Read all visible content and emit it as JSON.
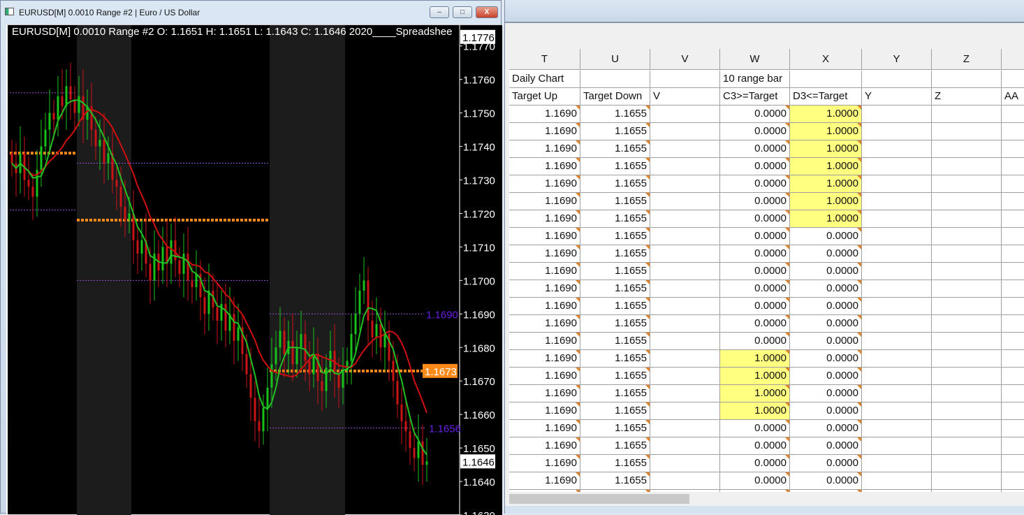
{
  "chart_window": {
    "title": "EURUSD[M]  0.0010 Range  #2 | Euro / US Dollar",
    "info_line": "EURUSD[M]  0.0010 Range  #2 O: 1.1651 H: 1.1651 L: 1.1643 C: 1.1646 2020____Spreadshee",
    "buttons": {
      "minimize": "–",
      "maximize": "□",
      "close": "X"
    }
  },
  "chart_data": {
    "type": "candlestick",
    "symbol": "EURUSD[M]",
    "ylim": [
      1.163,
      1.17762
    ],
    "y_ticks": [
      "1.1770",
      "1.1760",
      "1.1750",
      "1.1740",
      "1.1730",
      "1.1720",
      "1.1710",
      "1.1700",
      "1.1690",
      "1.1680",
      "1.1670",
      "1.1660",
      "1.1650",
      "1.1640",
      "1.1630"
    ],
    "top_price_label": "1.1776",
    "current_price_label": "1.1646",
    "current_price": 1.1646,
    "closes": [
      1.1735,
      1.1732,
      1.1738,
      1.173,
      1.1728,
      1.1725,
      1.1733,
      1.174,
      1.1745,
      1.175,
      1.1748,
      1.1755,
      1.1752,
      1.1758,
      1.1754,
      1.175,
      1.1755,
      1.1748,
      1.1752,
      1.1745,
      1.174,
      1.1742,
      1.1735,
      1.1738,
      1.173,
      1.1728,
      1.1722,
      1.1718,
      1.172,
      1.1712,
      1.1708,
      1.1712,
      1.1705,
      1.17,
      1.1708,
      1.1703,
      1.171,
      1.1705,
      1.1712,
      1.1706,
      1.1702,
      1.1708,
      1.17,
      1.1698,
      1.1702,
      1.1695,
      1.169,
      1.1697,
      1.1692,
      1.1688,
      1.1693,
      1.1685,
      1.169,
      1.1682,
      1.1686,
      1.1678,
      1.1672,
      1.1665,
      1.1658,
      1.1655,
      1.1662,
      1.1668,
      1.1675,
      1.168,
      1.1685,
      1.1678,
      1.1682,
      1.1675,
      1.168,
      1.1684,
      1.1676,
      1.1672,
      1.1678,
      1.167,
      1.1667,
      1.1674,
      1.1679,
      1.1672,
      1.1668,
      1.1673,
      1.1676,
      1.1684,
      1.169,
      1.1697,
      1.17,
      1.1688,
      1.1683,
      1.1687,
      1.168,
      1.1684,
      1.1676,
      1.167,
      1.1663,
      1.1658,
      1.1655,
      1.165,
      1.1647,
      1.1652,
      1.1645,
      1.1646
    ],
    "sessions": [
      {
        "start_bar": 0,
        "end_bar": 15,
        "shaded": false,
        "upper": 1.1756,
        "mid": 1.1738,
        "lower": 1.1721
      },
      {
        "start_bar": 16,
        "end_bar": 28,
        "shaded": true,
        "upper": 1.1735,
        "mid": 1.1718,
        "lower": 1.17
      },
      {
        "start_bar": 29,
        "end_bar": 61,
        "shaded": false,
        "upper": 1.1735,
        "mid": 1.1718,
        "lower": 1.17
      },
      {
        "start_bar": 62,
        "end_bar": 79,
        "shaded": true,
        "upper": 1.169,
        "mid": 1.1673,
        "lower": 1.1656
      },
      {
        "start_bar": 80,
        "end_bar": 99,
        "shaded": false,
        "upper": 1.169,
        "mid": 1.1673,
        "lower": 1.1656
      }
    ],
    "level_labels": {
      "upper": "1.1690",
      "mid": "1.1673",
      "lower": "1.1656"
    },
    "fast_ma_period": 5,
    "slow_ma_period": 12,
    "colors": {
      "up": "#19c219",
      "down": "#c81414",
      "fast_ma": "#22c022",
      "slow_ma": "#d01010",
      "mid_level": "#ff8a1a",
      "band": "#9a4fd8",
      "label_purple": "#6a1ee0"
    }
  },
  "spreadsheet": {
    "columns": [
      "T",
      "U",
      "V",
      "W",
      "X",
      "Y",
      "Z",
      ""
    ],
    "row1": [
      "Daily Chart",
      "",
      "",
      "10 range bar",
      "",
      "",
      "",
      ""
    ],
    "row2": [
      "Target Up",
      "Target Down",
      "V",
      "C3>=Target",
      "D3<=Target",
      "Y",
      "Z",
      "AA"
    ],
    "target_up": "1.1690",
    "target_down": "1.1655",
    "c3": [
      "0.0000",
      "0.0000",
      "0.0000",
      "0.0000",
      "0.0000",
      "0.0000",
      "0.0000",
      "0.0000",
      "0.0000",
      "0.0000",
      "0.0000",
      "0.0000",
      "0.0000",
      "0.0000",
      "1.0000",
      "1.0000",
      "1.0000",
      "1.0000",
      "0.0000",
      "0.0000",
      "0.0000",
      "0.0000"
    ],
    "d3": [
      "1.0000",
      "1.0000",
      "1.0000",
      "1.0000",
      "1.0000",
      "1.0000",
      "1.0000",
      "0.0000",
      "0.0000",
      "0.0000",
      "0.0000",
      "0.0000",
      "0.0000",
      "0.0000",
      "0.0000",
      "0.0000",
      "0.0000",
      "0.0000",
      "0.0000",
      "0.0000",
      "0.0000",
      "0.0000"
    ],
    "highlight_color": "#ffff80"
  }
}
